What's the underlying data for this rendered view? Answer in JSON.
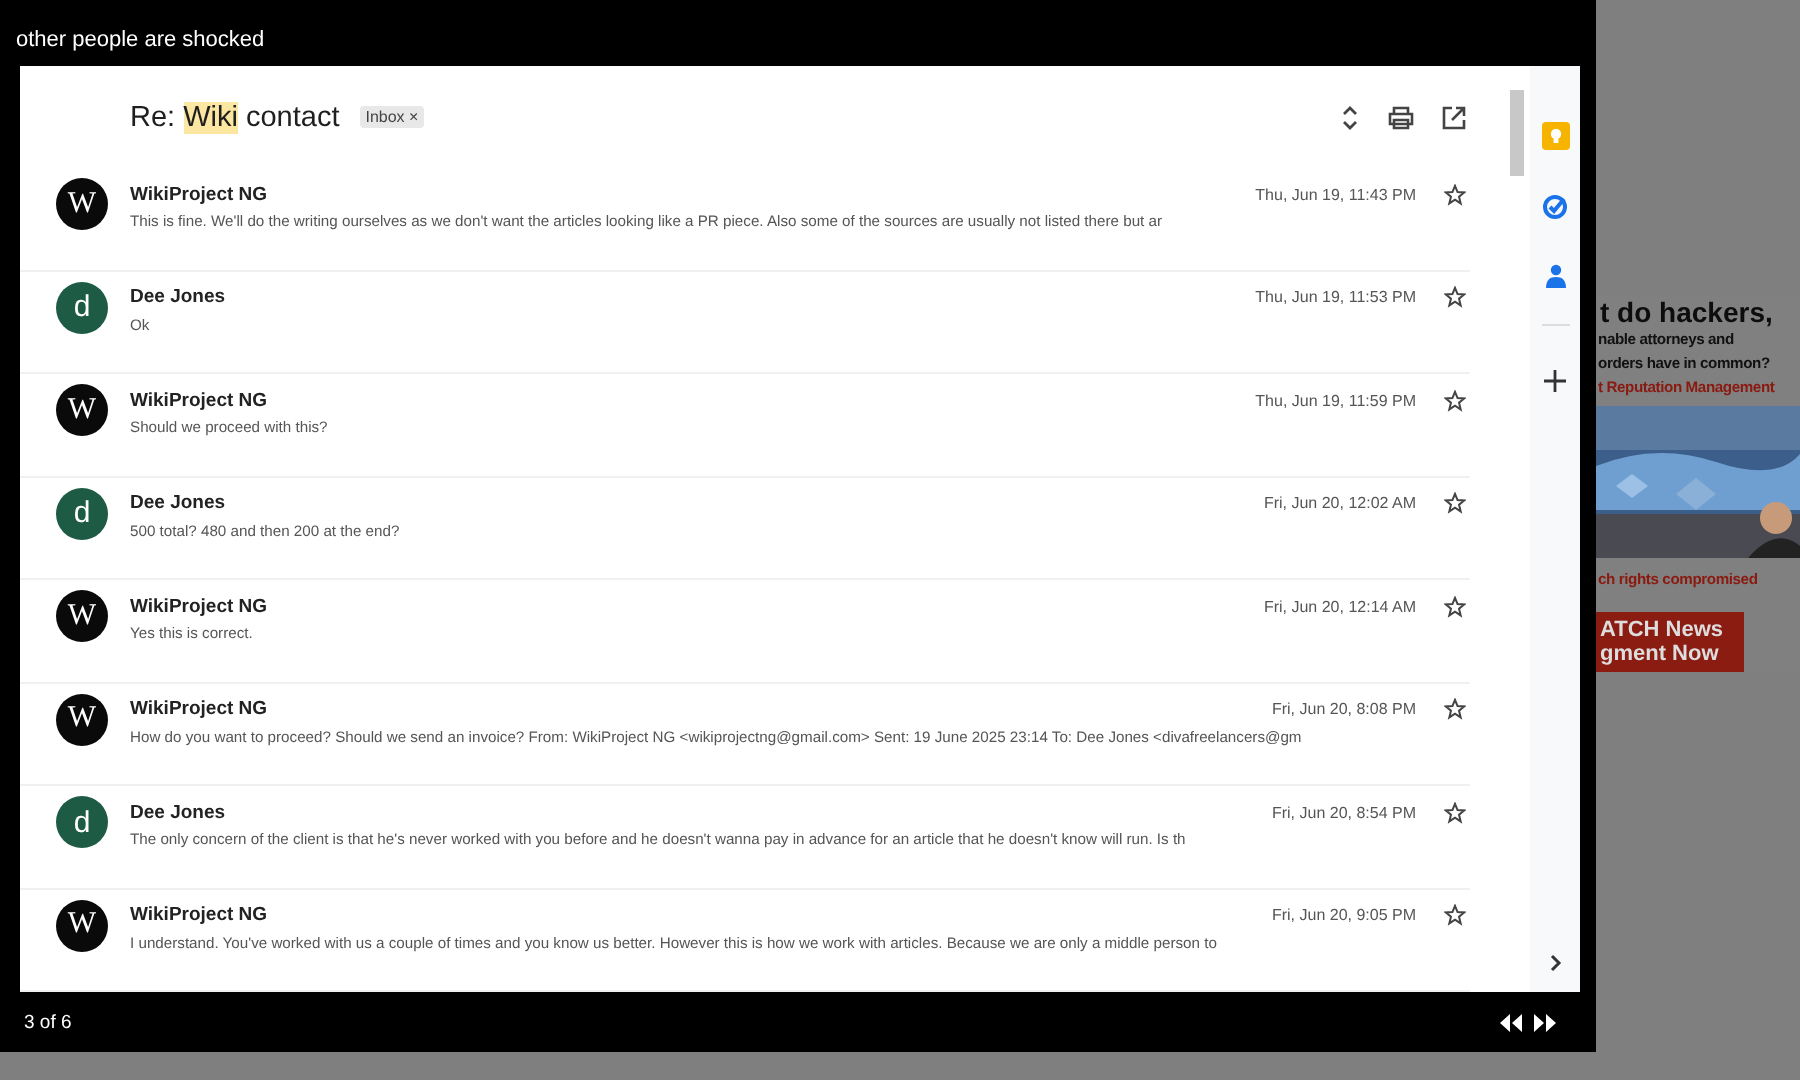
{
  "lightbox": {
    "caption": "other people are shocked",
    "counter": "3 of 6"
  },
  "email": {
    "subject": [
      {
        "text": "Re:",
        "highlighted": false
      },
      {
        "text": "Wiki",
        "highlighted": true
      },
      {
        "text": "contact",
        "highlighted": false
      }
    ],
    "label": {
      "text": "Inbox",
      "remove": "×"
    },
    "messages": [
      {
        "avatar": {
          "kind": "logo",
          "text": "W"
        },
        "sender": "WikiProject NG",
        "date": "Thu, Jun 19, 11:43 PM",
        "snippet": "This is fine. We'll do the writing ourselves as we don't want the articles looking like a PR piece. Also some of the sources are usually not listed there but ar",
        "starred": false
      },
      {
        "avatar": {
          "kind": "letter",
          "text": "d"
        },
        "sender": "Dee Jones",
        "date": "Thu, Jun 19, 11:53 PM",
        "snippet": "Ok",
        "starred": false
      },
      {
        "avatar": {
          "kind": "logo",
          "text": "W"
        },
        "sender": "WikiProject NG",
        "date": "Thu, Jun 19, 11:59 PM",
        "snippet": "Should we proceed with this?",
        "starred": false
      },
      {
        "avatar": {
          "kind": "letter",
          "text": "d"
        },
        "sender": "Dee Jones",
        "date": "Fri, Jun 20, 12:02 AM",
        "snippet": "500 total? 480 and then 200 at the end?",
        "starred": false
      },
      {
        "avatar": {
          "kind": "logo",
          "text": "W"
        },
        "sender": "WikiProject NG",
        "date": "Fri, Jun 20, 12:14 AM",
        "snippet": "Yes this is correct.",
        "starred": false
      },
      {
        "avatar": {
          "kind": "logo",
          "text": "W"
        },
        "sender": "WikiProject NG",
        "date": "Fri, Jun 20, 8:08 PM",
        "snippet": "How do you want to proceed? Should we send an invoice? From: WikiProject NG <wikiprojectng@gmail.com> Sent: 19 June 2025 23:14 To: Dee Jones <divafreelancers@gm",
        "starred": false
      },
      {
        "avatar": {
          "kind": "letter",
          "text": "d"
        },
        "sender": "Dee Jones",
        "date": "Fri, Jun 20, 8:54 PM",
        "snippet": "The only concern of the client is that he's never worked with you before and he doesn't wanna pay in advance for an article that he doesn't know will run. Is th",
        "starred": false
      },
      {
        "avatar": {
          "kind": "logo",
          "text": "W"
        },
        "sender": "WikiProject NG",
        "date": "Fri, Jun 20, 9:05 PM",
        "snippet": "I understand. You've worked with us a couple of times and you know us better. However this is how we work with articles. Because we are only a middle person to",
        "starred": false
      }
    ]
  },
  "background_ad": {
    "headline": "t do hackers,",
    "lines": [
      {
        "text": "nable attorneys and",
        "kind": "dark"
      },
      {
        "text": "orders have in common?",
        "kind": "dark"
      },
      {
        "text": "t Reputation Management",
        "kind": "red"
      }
    ],
    "video": {
      "kind": "picture"
    },
    "footer_line": "ch rights compromised",
    "button": [
      "ATCH News",
      "gment Now"
    ]
  }
}
